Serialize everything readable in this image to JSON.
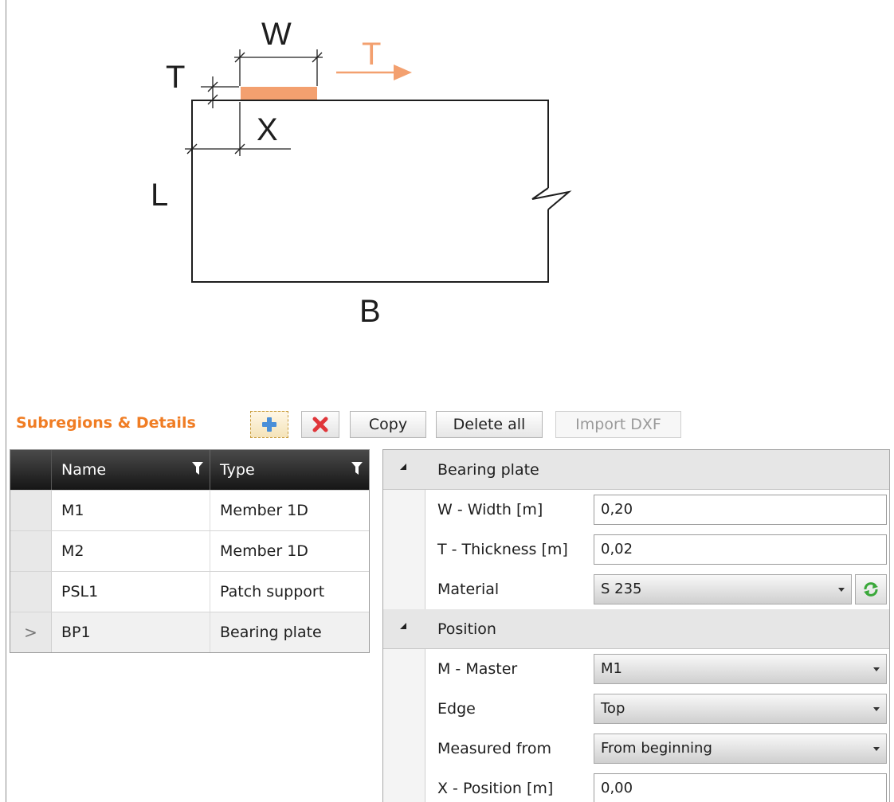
{
  "diagram": {
    "label_w": "W",
    "label_t": "T",
    "label_t_arrow": "T",
    "label_x": "X",
    "label_l": "L",
    "label_b": "B",
    "accent_color": "#f3a06f"
  },
  "toolbar": {
    "title": "Subregions & Details",
    "add_icon": "plus-icon",
    "delete_icon": "x-icon",
    "copy_label": "Copy",
    "delete_all_label": "Delete all",
    "import_dxf_label": "Import DXF"
  },
  "grid": {
    "columns": [
      "Name",
      "Type"
    ],
    "rows": [
      {
        "indicator": "",
        "name": "M1",
        "type": "Member 1D"
      },
      {
        "indicator": "",
        "name": "M2",
        "type": "Member 1D"
      },
      {
        "indicator": "",
        "name": "PSL1",
        "type": "Patch support"
      },
      {
        "indicator": ">",
        "name": "BP1",
        "type": "Bearing plate"
      }
    ]
  },
  "properties": {
    "bearing_plate": {
      "header": "Bearing plate",
      "width_label": "W - Width [m]",
      "width_value": "0,20",
      "thickness_label": "T - Thickness [m]",
      "thickness_value": "0,02",
      "material_label": "Material",
      "material_value": "S 235"
    },
    "position": {
      "header": "Position",
      "master_label": "M - Master",
      "master_value": "M1",
      "edge_label": "Edge",
      "edge_value": "Top",
      "measured_label": "Measured from",
      "measured_value": "From beginning",
      "x_label": "X - Position [m]",
      "x_value": "0,00"
    }
  }
}
